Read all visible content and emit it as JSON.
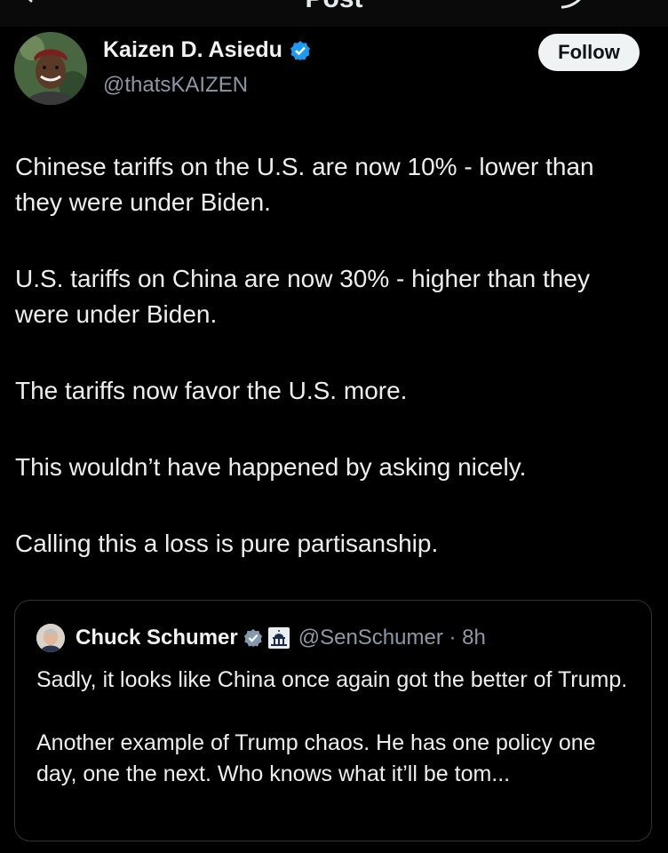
{
  "header": {
    "title": "Post"
  },
  "author": {
    "name": "Kaizen D. Asiedu",
    "handle": "@thatsKAIZEN",
    "follow_label": "Follow"
  },
  "post": {
    "paragraphs": [
      "Chinese tariffs on the U.S. are now 10% - lower than they were under Biden.",
      "U.S. tariffs on China are now 30% - higher than they were under Biden.",
      "The tariffs now favor the U.S. more.",
      "This wouldn’t have happened by asking nicely.",
      "Calling this a loss is pure partisanship."
    ]
  },
  "quoted": {
    "name": "Chuck Schumer",
    "handle_time": "@SenSchumer · 8h",
    "paragraphs": [
      "Sadly, it looks like China once again got the better of Trump.",
      "Another example of Trump chaos. He has one policy one day, one the next. Who knows what it’ll be tom..."
    ]
  },
  "colors": {
    "background": "#000000",
    "text": "#e7e9ea",
    "secondary_text": "#8b98a5",
    "verified_blue": "#1d9bf0",
    "follow_button_bg": "#eff3f4",
    "border": "#2f3336"
  },
  "icons": [
    "back-arrow-icon",
    "grok-icon",
    "verified-badge-icon",
    "gray-verified-badge-icon",
    "capitol-icon"
  ]
}
